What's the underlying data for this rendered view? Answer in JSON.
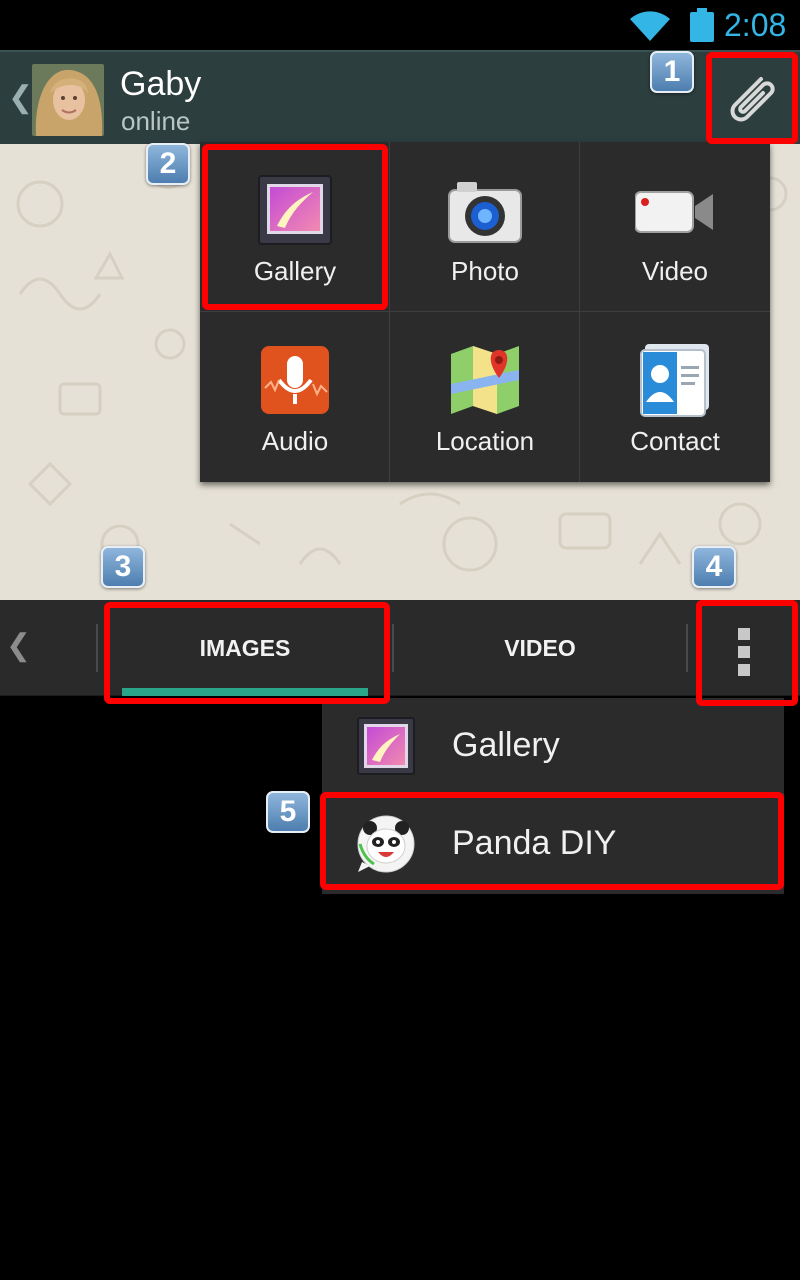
{
  "status_bar": {
    "time": "2:08",
    "wifi_icon": "wifi-icon",
    "battery_icon": "battery-icon",
    "accent_color": "#33b5e5"
  },
  "chat_header": {
    "contact_name": "Gaby",
    "status": "online",
    "back_icon": "chevron-left-icon",
    "attach_icon": "paperclip-icon"
  },
  "attach_menu": {
    "items": [
      {
        "label": "Gallery",
        "icon": "gallery-icon"
      },
      {
        "label": "Photo",
        "icon": "camera-icon"
      },
      {
        "label": "Video",
        "icon": "video-camera-icon"
      },
      {
        "label": "Audio",
        "icon": "microphone-icon"
      },
      {
        "label": "Location",
        "icon": "map-pin-icon"
      },
      {
        "label": "Contact",
        "icon": "contact-card-icon"
      }
    ]
  },
  "tabs": {
    "back_icon": "chevron-left-icon",
    "items": [
      {
        "label": "IMAGES",
        "selected": true
      },
      {
        "label": "VIDEO",
        "selected": false
      }
    ],
    "indicator_color": "#2aa589",
    "overflow_icon": "overflow-menu-icon"
  },
  "popup_menu": {
    "items": [
      {
        "label": "Gallery",
        "icon": "gallery-icon"
      },
      {
        "label": "Panda DIY",
        "icon": "panda-icon"
      }
    ]
  },
  "annotations": {
    "badges": [
      "1",
      "2",
      "3",
      "4",
      "5"
    ],
    "highlight_color": "#ff0000"
  }
}
